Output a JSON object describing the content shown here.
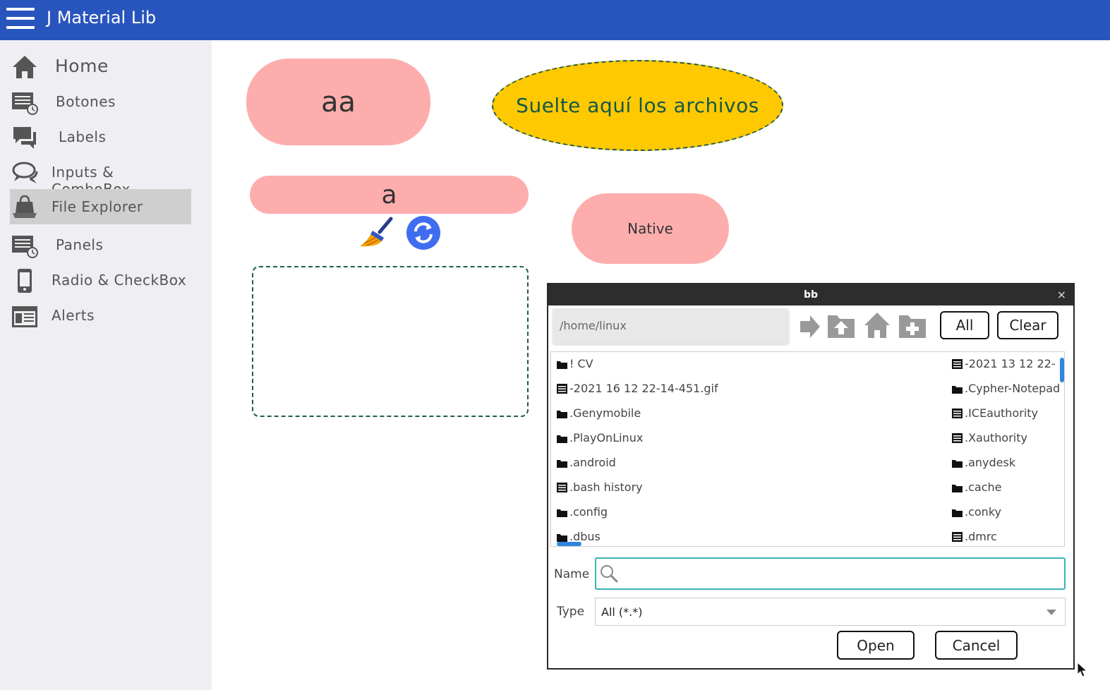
{
  "app": {
    "title": "J Material Lib"
  },
  "sidebar": {
    "items": [
      {
        "label": "Home",
        "icon": "home-icon",
        "active": false
      },
      {
        "label": "Botones",
        "icon": "list-clock-icon",
        "active": false
      },
      {
        "label": "Labels",
        "icon": "chat-bubbles-icon",
        "active": false
      },
      {
        "label": "Inputs & ComboBox",
        "icon": "speech-bubbles-icon",
        "active": false
      },
      {
        "label": "File Explorer",
        "icon": "shopping-bag-icon",
        "active": true
      },
      {
        "label": "Panels",
        "icon": "list-clock-icon",
        "active": false
      },
      {
        "label": "Radio & CheckBox",
        "icon": "mobile-phone-icon",
        "active": false
      },
      {
        "label": "Alerts",
        "icon": "window-icon",
        "active": false
      }
    ]
  },
  "main": {
    "pill_large": "aa",
    "drop_zone_text": "Suelte aquí los archivos",
    "pill_wide": "a",
    "native_button": "Native"
  },
  "dialog": {
    "title": "bb",
    "close": "×",
    "path": "/home/linux",
    "all_button": "All",
    "clear_button": "Clear",
    "files_left": [
      {
        "name": "! CV",
        "type": "folder"
      },
      {
        "name": "-2021 16 12 22-14-451.gif",
        "type": "file"
      },
      {
        "name": ".Genymobile",
        "type": "folder"
      },
      {
        "name": ".PlayOnLinux",
        "type": "folder"
      },
      {
        "name": ".android",
        "type": "folder"
      },
      {
        "name": ".bash history",
        "type": "file"
      },
      {
        "name": ".config",
        "type": "folder"
      },
      {
        "name": ".dbus",
        "type": "folder"
      }
    ],
    "files_right": [
      {
        "name": "-2021 13 12 22-",
        "type": "file"
      },
      {
        "name": ".Cypher-Notepad",
        "type": "folder"
      },
      {
        "name": ".ICEauthority",
        "type": "file"
      },
      {
        "name": ".Xauthority",
        "type": "file"
      },
      {
        "name": ".anydesk",
        "type": "folder"
      },
      {
        "name": ".cache",
        "type": "folder"
      },
      {
        "name": ".conky",
        "type": "folder"
      },
      {
        "name": ".dmrc",
        "type": "file"
      }
    ],
    "name_label": "Name",
    "name_value": "",
    "type_label": "Type",
    "type_value": "All (*.*)",
    "open_button": "Open",
    "cancel_button": "Cancel"
  },
  "colors": {
    "topbar": "#2855bd",
    "sidebar_bg": "#efeff3",
    "sidebar_active": "#cfcfcf",
    "pill": "#feadad",
    "drop_zone": "#ffc901",
    "drop_zone_text": "#13574a",
    "accent_blue": "#3f6cf0",
    "scrollbar": "#2e86e0"
  }
}
